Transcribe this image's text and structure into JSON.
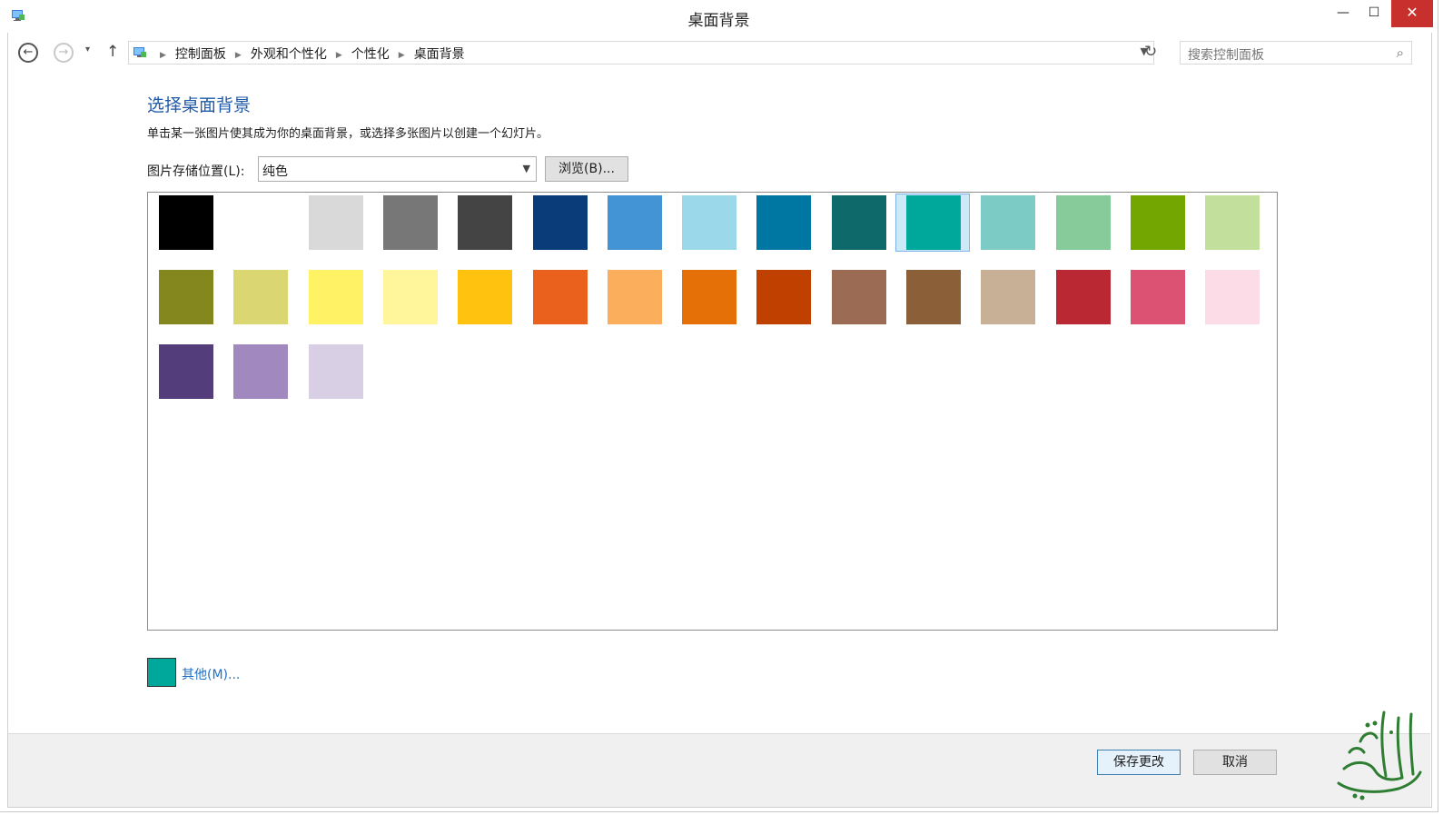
{
  "window": {
    "title": "桌面背景",
    "minimize": "—",
    "maximize": "☐",
    "close": "✕"
  },
  "nav": {
    "back": "←",
    "forward": "→",
    "dropdown": "▾",
    "up": "↑",
    "refresh": "↻"
  },
  "breadcrumbs": [
    "控制面板",
    "外观和个性化",
    "个性化",
    "桌面背景"
  ],
  "search": {
    "placeholder": "搜索控制面板"
  },
  "main": {
    "title": "选择桌面背景",
    "description": "单击某一张图片使其成为你的桌面背景，或选择多张图片以创建一个幻灯片。",
    "location_label": "图片存储位置(L):",
    "location_value": "纯色",
    "browse_label": "浏览(B)..."
  },
  "swatches": [
    "#000000",
    "#ffffff",
    "#d9d9d9",
    "#777777",
    "#444444",
    "#0b3c7a",
    "#4394d4",
    "#9bd9ea",
    "#0076a3",
    "#0e6a6a",
    "#00a89c",
    "#7dcbc5",
    "#86cb99",
    "#73a600",
    "#c2df9b",
    "#84861e",
    "#dad671",
    "#fff265",
    "#fff69c",
    "#ffc20e",
    "#ea611d",
    "#fbae5c",
    "#e57008",
    "#c04000",
    "#9c6b53",
    "#8b6039",
    "#c8b097",
    "#ba2834",
    "#dc5272",
    "#fcdde7",
    "#533d7b",
    "#a188bf",
    "#d9cfe4"
  ],
  "selected_color": "#00a89c",
  "other": {
    "label": "其他(M)...",
    "color": "#00a89c"
  },
  "footer": {
    "save_label": "保存更改",
    "cancel_label": "取消"
  }
}
